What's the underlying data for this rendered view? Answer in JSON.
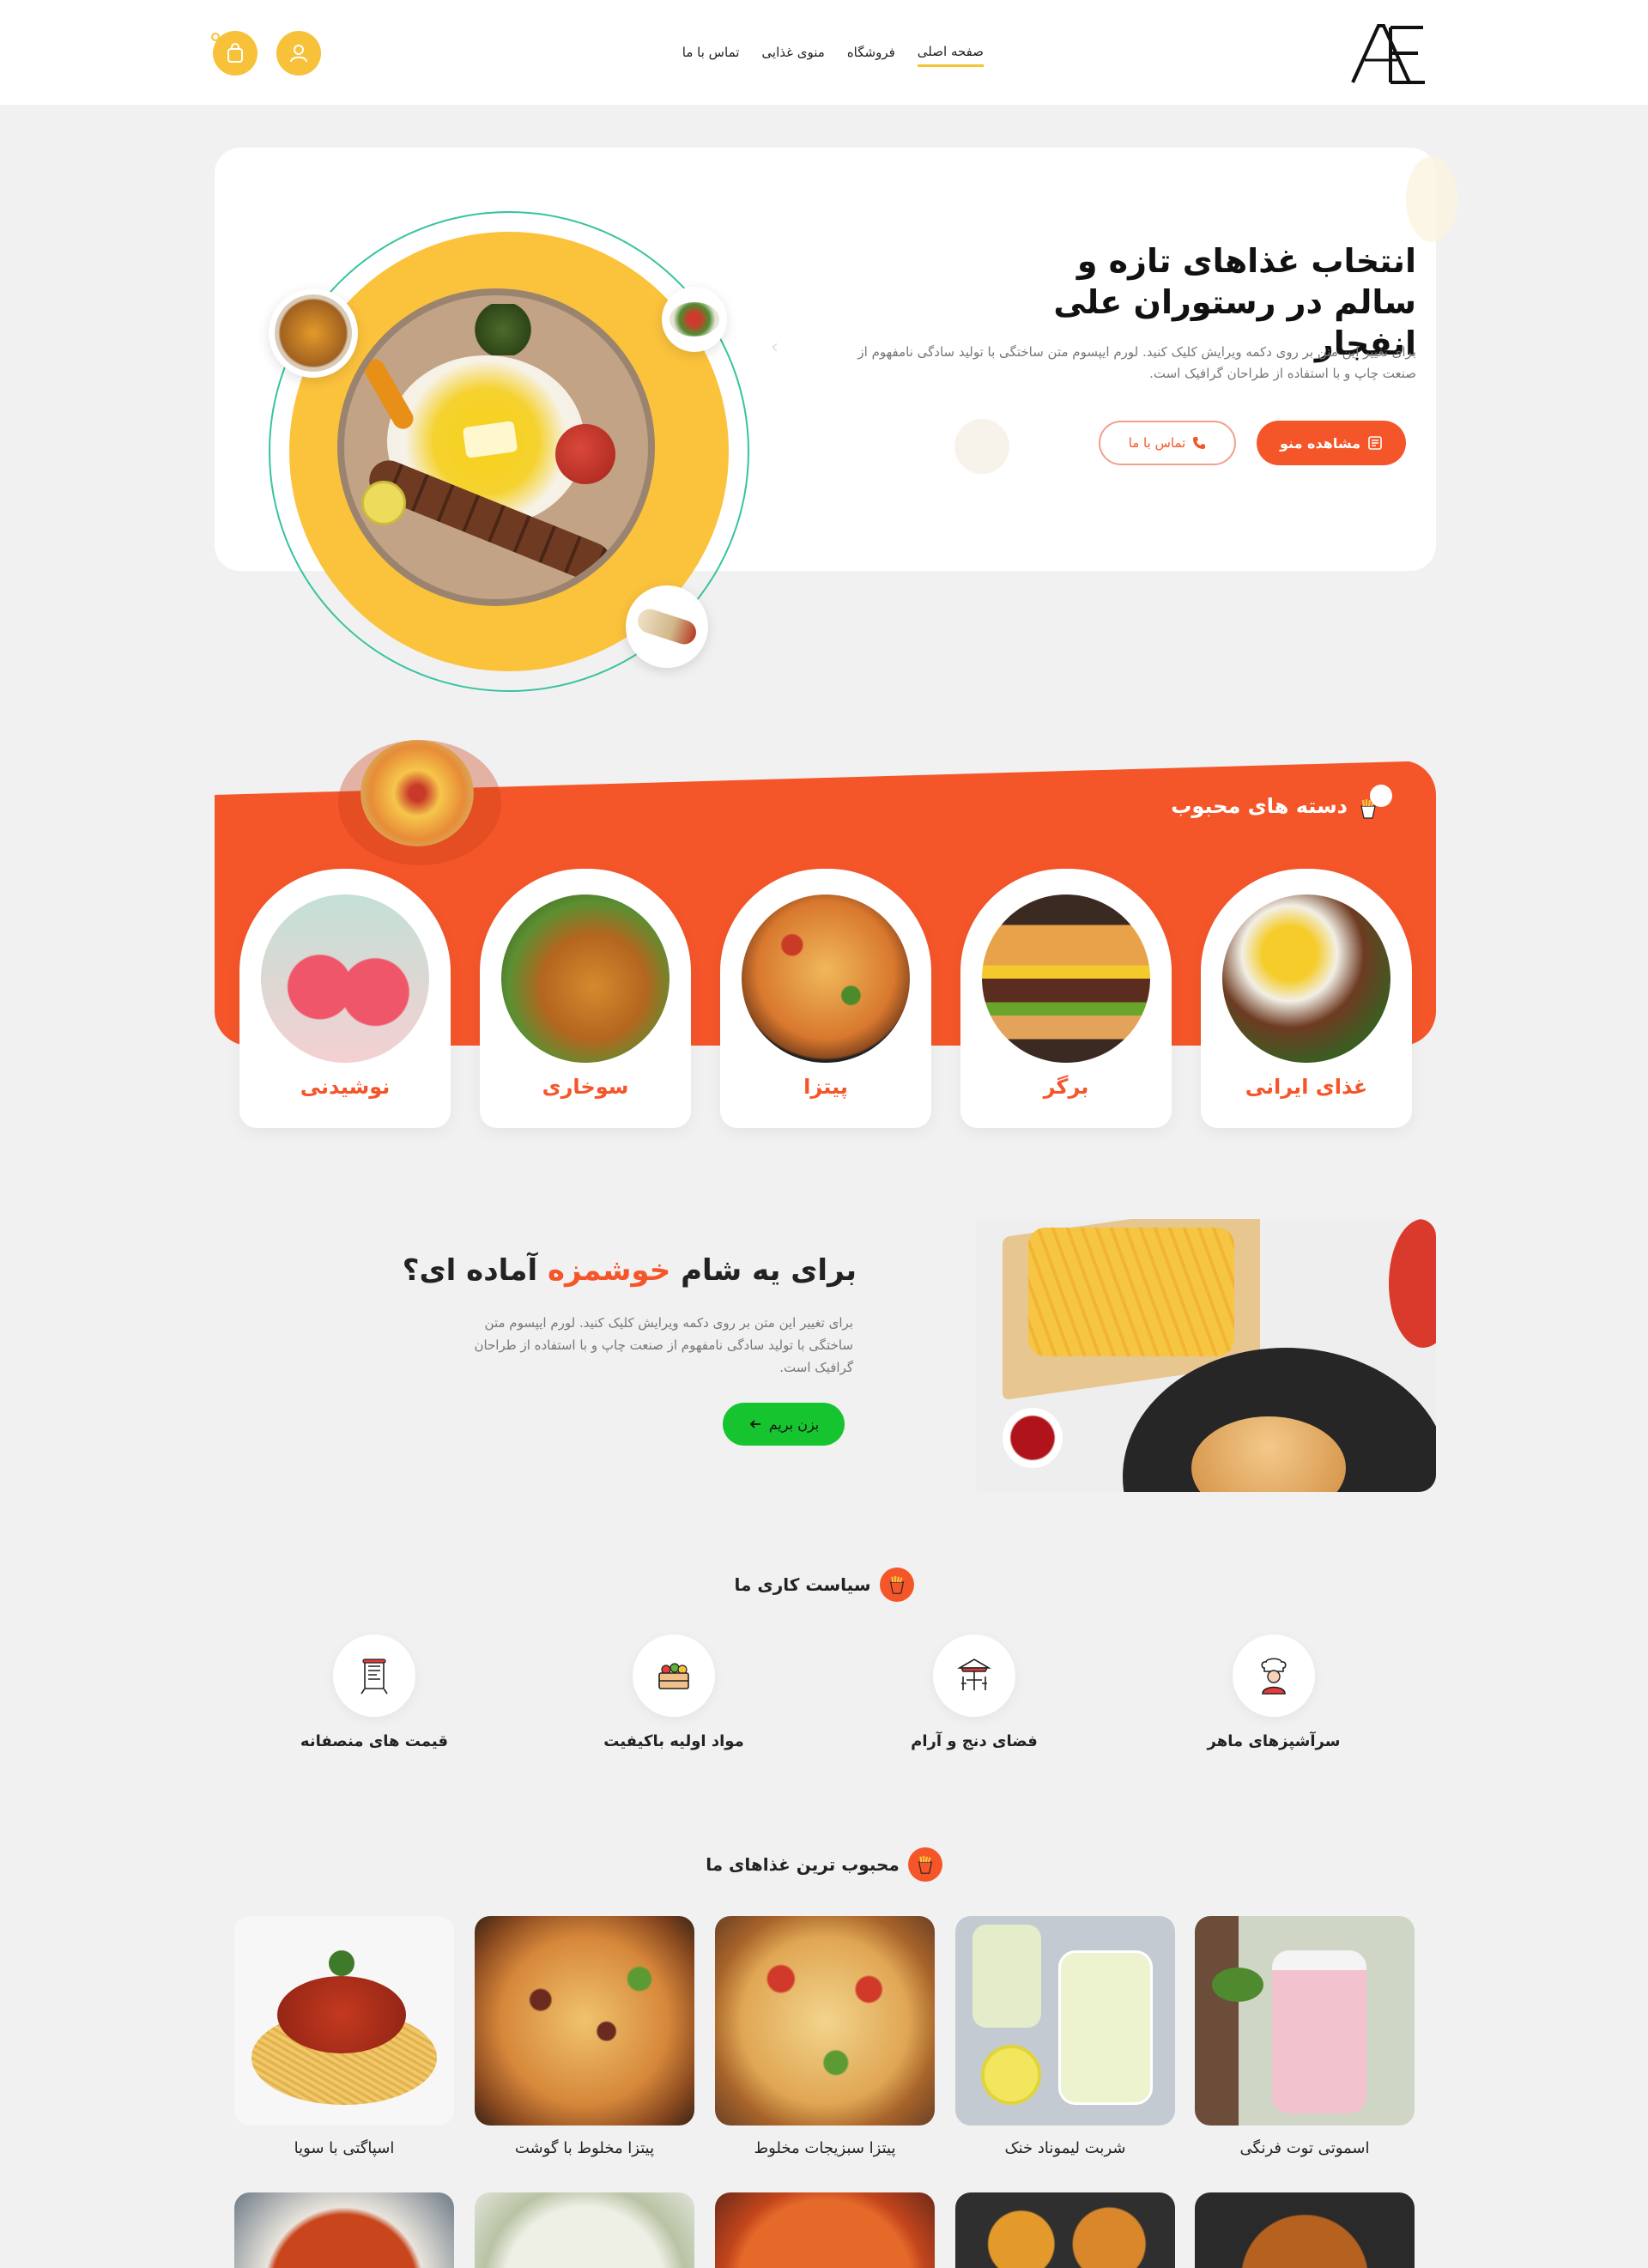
{
  "header": {
    "logo_text": "AE",
    "nav": [
      {
        "label": "صفحه اصلی",
        "active": true
      },
      {
        "label": "فروشگاه",
        "active": false
      },
      {
        "label": "منوی غذایی",
        "active": false
      },
      {
        "label": "تماس با ما",
        "active": false
      }
    ],
    "icons": {
      "user": "user-icon",
      "cart": "shopping-bag-icon"
    }
  },
  "hero": {
    "title": "انتخاب غذاهای تازه و سالم در رستوران علی انفجار",
    "description": "برای تغییر این متن بر روی دکمه ویرایش کلیک کنید. لورم ایپسوم متن ساختگی با تولید سادگی نامفهوم از صنعت چاپ و با استفاده از طراحان گرافیک است.",
    "primary_button": "مشاهده منو",
    "secondary_button": "تماس با ما"
  },
  "categories": {
    "title": "دسته های محبوب",
    "items": [
      {
        "label": "غذای ایرانی"
      },
      {
        "label": "برگر"
      },
      {
        "label": "پیتزا"
      },
      {
        "label": "سوخاری"
      },
      {
        "label": "نوشیدنی"
      }
    ]
  },
  "promo": {
    "title_before": "برای یه شام ",
    "title_highlight": "خوشمزه",
    "title_after": " آماده ای؟",
    "description": "برای تغییر این متن بر روی دکمه ویرایش کلیک کنید. لورم ایپسوم متن ساختگی با تولید سادگی نامفهوم از صنعت چاپ و با استفاده از طراحان گرافیک است.",
    "button": "بزن بریم"
  },
  "policy": {
    "title": "سیاست کاری ما",
    "items": [
      {
        "label": "سرآشپزهای ماهر",
        "icon": "chef-icon"
      },
      {
        "label": "فضای دنج و آرام",
        "icon": "cafe-table-icon"
      },
      {
        "label": "مواد اولیه باکیفیت",
        "icon": "vegetable-crate-icon"
      },
      {
        "label": "قیمت های منصفانه",
        "icon": "menu-board-icon"
      }
    ]
  },
  "popular": {
    "title": "محبوب ترین غذاهای ما",
    "items": [
      {
        "label": "اسموتی توت فرنگی"
      },
      {
        "label": "شربت لیموناد خنک"
      },
      {
        "label": "پیتزا سبزیجات مخلوط"
      },
      {
        "label": "پیتزا مخلوط با گوشت"
      },
      {
        "label": "اسپاگتی با سویا"
      }
    ]
  },
  "colors": {
    "primary": "#f4562a",
    "yellow": "#f7c23a",
    "green": "#15c42f",
    "teal_ring": "#37c3a0"
  }
}
